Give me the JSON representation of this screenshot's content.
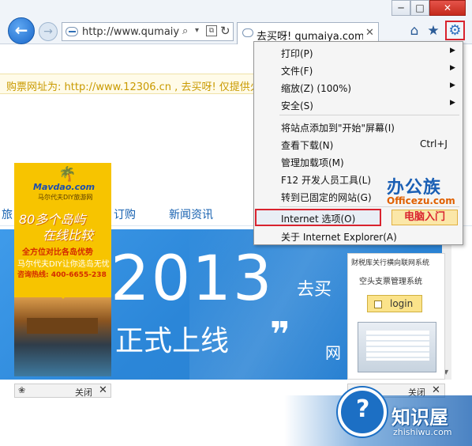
{
  "window": {
    "minimize": "─",
    "maximize": "□",
    "close": "✕"
  },
  "toolbar": {
    "back_glyph": "←",
    "forward_glyph": "→",
    "address_url": "http://www.qumaiy",
    "search_glyph": "⌕",
    "dropdown_glyph": "▾",
    "refresh_glyph": "↻",
    "tab_title": "去买呀! qumaiya.com-...",
    "tab_close": "✕",
    "home_glyph": "⌂",
    "favorites_glyph": "★",
    "tools_glyph": "⚙"
  },
  "page": {
    "notice": "购票网址为: http://www.12306.cn , 去买呀! 仅提供火车",
    "nav": [
      "旅",
      "订购",
      "新闻资讯"
    ],
    "banner": {
      "year": "2013",
      "go": "去买",
      "subtitle": "正式上线",
      "quote": "❞",
      "net": "网"
    },
    "ad_left": {
      "logo": "Mavdao.com",
      "logo_sub": "马尔代夫DIY旅游网",
      "headline1": "80多个岛屿",
      "headline2": "在线比较",
      "line1": "全方位对比各岛优势",
      "line2": "马尔代夫DIY让你选岛无忧",
      "phone": "咨询热线: 400-6655-238"
    },
    "ad_right": {
      "title": "财税库关行横向联网系统",
      "subtitle": "空头支票管理系统",
      "login": "login"
    },
    "ad_close_label": "关闭",
    "ad_close_x": "✕",
    "paw_glyph": "❀",
    "scroll_left": "‹",
    "scroll_up": "▲",
    "scroll_down": "▼"
  },
  "menu": {
    "items": [
      {
        "label": "打印(P)",
        "arrow": "▶"
      },
      {
        "label": "文件(F)",
        "arrow": "▶"
      },
      {
        "label": "缩放(Z) (100%)",
        "arrow": "▶"
      },
      {
        "label": "安全(S)",
        "arrow": "▶"
      },
      {
        "label": "将站点添加到\"开始\"屏幕(I)"
      },
      {
        "label": "查看下载(N)",
        "shortcut": "Ctrl+J"
      },
      {
        "label": "管理加载项(M)"
      },
      {
        "label": "F12 开发人员工具(L)"
      },
      {
        "label": "转到已固定的网站(G)"
      },
      {
        "label": "Internet 选项(O)"
      },
      {
        "label": "关于 Internet Explorer(A)"
      }
    ],
    "highlighted_index": 9,
    "highlight_color": "#d9232e"
  },
  "watermark": {
    "logo_cn": "办公族",
    "logo_en": "Officezu.com",
    "logo_tag": "电脑入门",
    "site_glyph": "?",
    "site_name": "知识屋",
    "site_url": "zhishiwu.com"
  }
}
